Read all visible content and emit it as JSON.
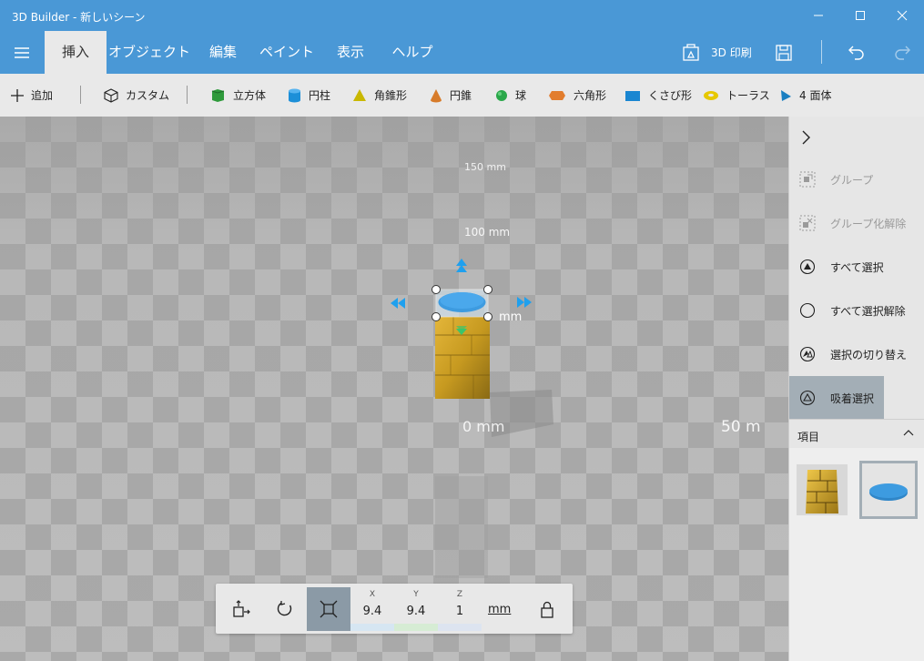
{
  "window": {
    "title": "3D Builder - 新しいシーン"
  },
  "tabs": [
    {
      "label": "挿入",
      "active": true
    },
    {
      "label": "オブジェクト",
      "active": false
    },
    {
      "label": "編集",
      "active": false
    },
    {
      "label": "ペイント",
      "active": false
    },
    {
      "label": "表示",
      "active": false
    },
    {
      "label": "ヘルプ",
      "active": false
    }
  ],
  "ribbon_right": {
    "print_label": "3D 印刷"
  },
  "toolbar": {
    "add_label": "追加",
    "custom_label": "カスタム",
    "shapes": [
      {
        "label": "立方体",
        "color": "#2e9a3b"
      },
      {
        "label": "円柱",
        "color": "#1c8fd8"
      },
      {
        "label": "角錐形",
        "color": "#c9b800"
      },
      {
        "label": "円錐",
        "color": "#d77b2a"
      },
      {
        "label": "球",
        "color": "#2aa84a"
      },
      {
        "label": "六角形",
        "color": "#e27d2e"
      },
      {
        "label": "くさび形",
        "color": "#1a86d1"
      },
      {
        "label": "トーラス",
        "color": "#e6c800"
      },
      {
        "label": "4 面体",
        "color": "#1a7fc1"
      }
    ]
  },
  "viewport": {
    "ruler_labels": [
      "150 mm",
      "100 mm",
      "mm",
      "0 mm",
      "50 m"
    ]
  },
  "transform": {
    "x_label": "X",
    "y_label": "Y",
    "z_label": "Z",
    "x": "9.4",
    "y": "9.4",
    "z": "1",
    "unit": "mm"
  },
  "right_panel": {
    "items": [
      {
        "label": "グループ",
        "enabled": false
      },
      {
        "label": "グループ化解除",
        "enabled": false
      },
      {
        "label": "すべて選択",
        "enabled": true
      },
      {
        "label": "すべて選択解除",
        "enabled": true
      },
      {
        "label": "選択の切り替え",
        "enabled": true
      },
      {
        "label": "吸着選択",
        "enabled": true,
        "active": true
      }
    ],
    "items_header": "項目"
  },
  "colors": {
    "accent": "#4a98d6",
    "ribbon_bg": "#e9e9e9",
    "selected_object": "#3d9be0",
    "gizmo": "#1fa0ee"
  }
}
